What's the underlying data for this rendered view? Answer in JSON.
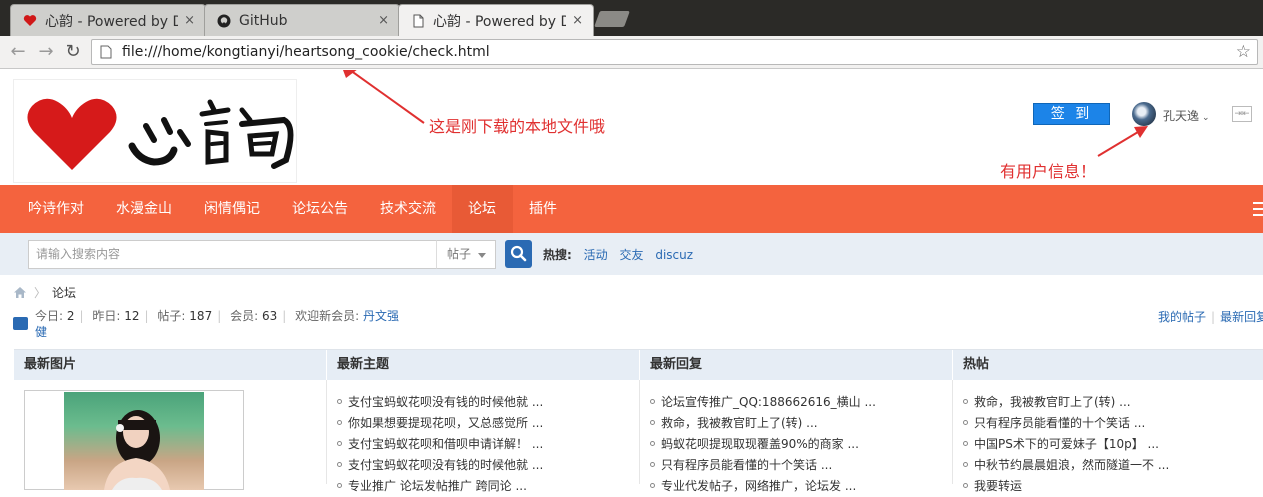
{
  "browser": {
    "tabs": [
      {
        "title": "心韵 - Powered by D",
        "close": "×"
      },
      {
        "title": "GitHub",
        "close": "×"
      },
      {
        "title": "心韵 - Powered by D",
        "close": "×"
      }
    ],
    "url": "file:///home/kongtianyi/heartsong_cookie/check.html",
    "back": "←",
    "forward": "→",
    "reload": "↻",
    "star": "☆"
  },
  "annotations": {
    "local_file": "这是刚下载的本地文件哦",
    "user_info": "有用户信息！"
  },
  "header": {
    "signin_label": "签 到",
    "username": "孔天逸",
    "caret": "⌄"
  },
  "nav": {
    "items": [
      {
        "label": "吟诗作对"
      },
      {
        "label": "水漫金山"
      },
      {
        "label": "闲情偶记"
      },
      {
        "label": "论坛公告"
      },
      {
        "label": "技术交流"
      },
      {
        "label": "论坛"
      },
      {
        "label": "插件"
      }
    ]
  },
  "search": {
    "placeholder": "请输入搜索内容",
    "type": "帖子",
    "hot_label": "热搜:",
    "hot_links": [
      "活动",
      "交友",
      "discuz"
    ]
  },
  "breadcrumb": {
    "current": "论坛",
    "sep": "〉"
  },
  "stats": {
    "today_label": "今日:",
    "today": "2",
    "yesterday_label": "昨日:",
    "yesterday": "12",
    "posts_label": "帖子:",
    "posts": "187",
    "members_label": "会员:",
    "members": "63",
    "welcome_label": "欢迎新会员:",
    "new_member_a": "丹文强",
    "new_member_b": "健",
    "pipe": "|"
  },
  "right_links": {
    "my_posts": "我的帖子",
    "latest_replies": "最新回复"
  },
  "grid": {
    "headers": [
      "最新图片",
      "最新主题",
      "最新回复",
      "热帖"
    ],
    "latest_topics": [
      "支付宝蚂蚁花呗没有钱的时候他就 ...",
      "你如果想要提现花呗，又总感觉所 ...",
      "支付宝蚂蚁花呗和借呗申请详解！ ...",
      "支付宝蚂蚁花呗没有钱的时候他就 ...",
      "专业推广 论坛发帖推广 跨同论 ..."
    ],
    "latest_replies": [
      "论坛宣传推广_QQ:188662616_横山 ...",
      "救命，我被教官盯上了(转) ...",
      "蚂蚁花呗提现取现覆盖90%的商家 ...",
      "只有程序员能看懂的十个笑话 ...",
      "专业代发帖子，网络推广，论坛发 ..."
    ],
    "hot_posts": [
      "救命，我被教官盯上了(转) ...",
      "只有程序员能看懂的十个笑话 ...",
      "中国PS术下的可爱妹子【10p】 ...",
      "中秋节约晨晨姐浪，然而隧道一不 ...",
      "我要转运"
    ]
  }
}
